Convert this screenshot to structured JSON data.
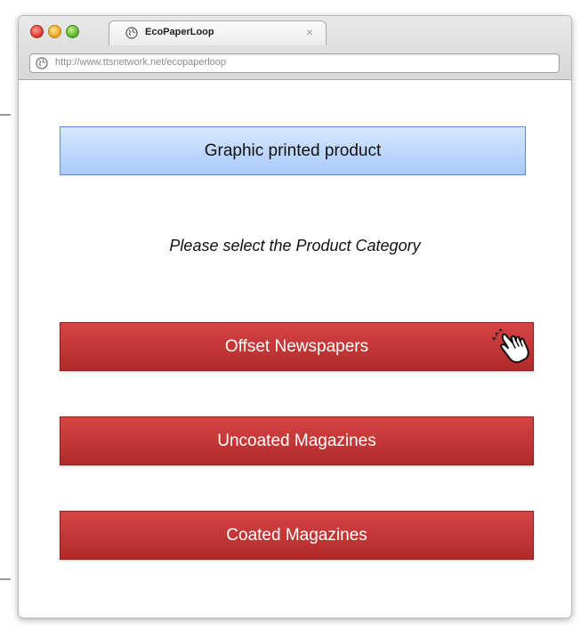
{
  "browser": {
    "tab_title": "EcoPaperLoop",
    "tab_close_glyph": "×",
    "url": "http://www.ttsnetwork.net/ecopaperloop"
  },
  "page": {
    "header": "Graphic printed product",
    "prompt": "Please select the Product Category",
    "categories": [
      {
        "label": "Offset Newspapers"
      },
      {
        "label": "Uncoated Magazines"
      },
      {
        "label": "Coated Magazines"
      }
    ]
  },
  "colors": {
    "button_red": "#c03434",
    "header_blue": "#bcd6fb",
    "header_border": "#5b8bd4"
  },
  "icons": [
    "globe-icon",
    "close-icon",
    "hand-pointer-icon"
  ]
}
